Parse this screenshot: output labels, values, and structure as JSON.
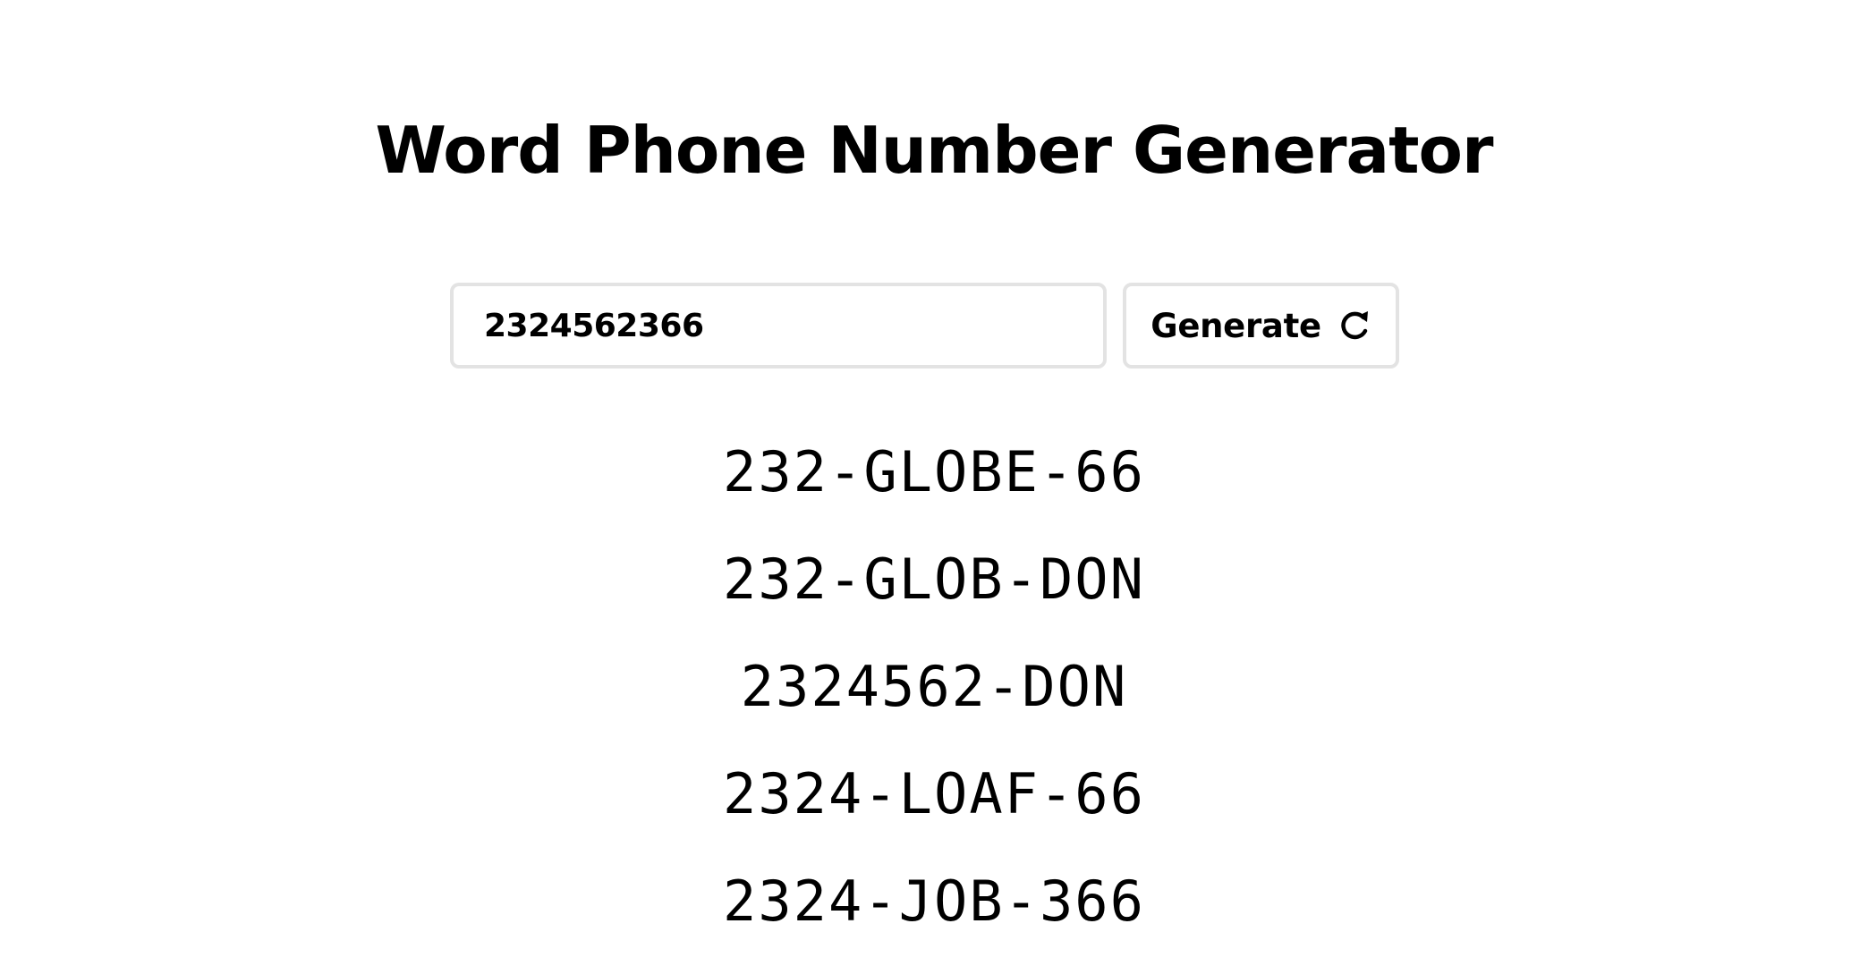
{
  "page": {
    "title": "Word Phone Number Generator"
  },
  "form": {
    "input_value": "2324562366",
    "generate_label": "Generate",
    "generate_icon": "refresh-icon"
  },
  "results": [
    "232-GLOBE-66",
    "232-GLOB-DON",
    "2324562-DON",
    "2324-LOAF-66",
    "2324-JOB-366"
  ],
  "colors": {
    "text": "#000000",
    "border": "#e3e3e3",
    "background": "#ffffff"
  }
}
